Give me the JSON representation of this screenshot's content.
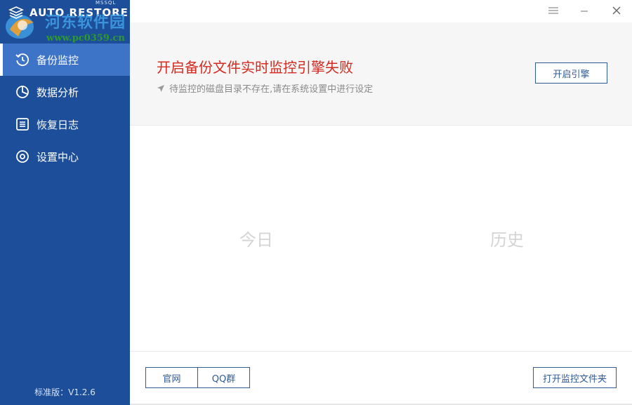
{
  "app": {
    "product_name": "AUTO RESTORE",
    "product_sub": "MSSQL",
    "version": "标准版：V1.2.6"
  },
  "watermark": {
    "cn": "河东软件园",
    "url": "www.pc0359.cn"
  },
  "sidebar": {
    "items": [
      {
        "label": "备份监控",
        "icon": "history-icon",
        "active": true
      },
      {
        "label": "数据分析",
        "icon": "pie-chart-icon",
        "active": false
      },
      {
        "label": "恢复日志",
        "icon": "log-list-icon",
        "active": false
      },
      {
        "label": "设置中心",
        "icon": "settings-icon",
        "active": false
      }
    ]
  },
  "status": {
    "title": "开启备份文件实时监控引擎失败",
    "subtitle": "待监控的磁盘目录不存在,请在系统设置中进行设定",
    "engine_button": "开启引擎",
    "title_color": "#d42a1f"
  },
  "stats": {
    "today_label": "今日",
    "history_label": "历史"
  },
  "footer": {
    "site_button": "官网",
    "qq_button": "QQ群",
    "open_folder_button": "打开监控文件夹"
  },
  "colors": {
    "sidebar": "#1d4e9a",
    "sidebar_active": "#3d74c8",
    "accent": "#2f5a96"
  }
}
